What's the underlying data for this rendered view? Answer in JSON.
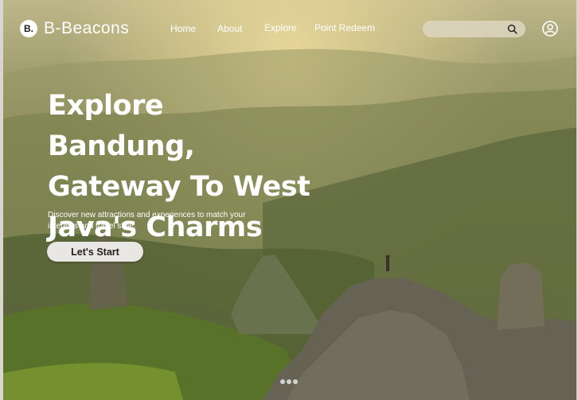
{
  "brand": {
    "badge": "B.",
    "name": "B-Beacons"
  },
  "nav": [
    {
      "label": "Home"
    },
    {
      "label": "About"
    },
    {
      "label": "Explore"
    },
    {
      "label": "Point Redeem"
    }
  ],
  "search": {
    "placeholder": ""
  },
  "hero": {
    "headline_lines": [
      "Explore Bandung,",
      "Gateway To West",
      "Java's Charms"
    ],
    "subtext": "Discover new attractions and experiences to match your interests and travel style.",
    "cta_label": "Let's Start"
  },
  "carousel": {
    "dot_count": 3
  },
  "colors": {
    "cta_bg": "#e9e7e3",
    "search_bg": "#ddd6c1",
    "text": "#ffffff"
  }
}
